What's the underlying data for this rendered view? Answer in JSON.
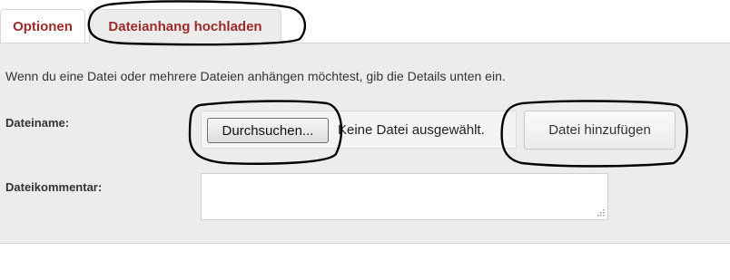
{
  "tabs": [
    {
      "label": "Optionen"
    },
    {
      "label": "Dateianhang hochladen"
    }
  ],
  "panel": {
    "intro_text": "Wenn du eine Datei oder mehrere Dateien anhängen möchtest, gib die Details unten ein.",
    "file_label": "Dateiname:",
    "browse_button": "Durchsuchen...",
    "file_status": "Keine Datei ausgewählt.",
    "add_button": "Datei hinzufügen",
    "comment_label": "Dateikommentar:",
    "comment_value": ""
  },
  "colors": {
    "tab_text": "#9b2b2b",
    "panel_bg": "#ececec",
    "annotation_stroke": "#000000"
  },
  "icons": {
    "resize_grip": "resize-grip-icon"
  }
}
